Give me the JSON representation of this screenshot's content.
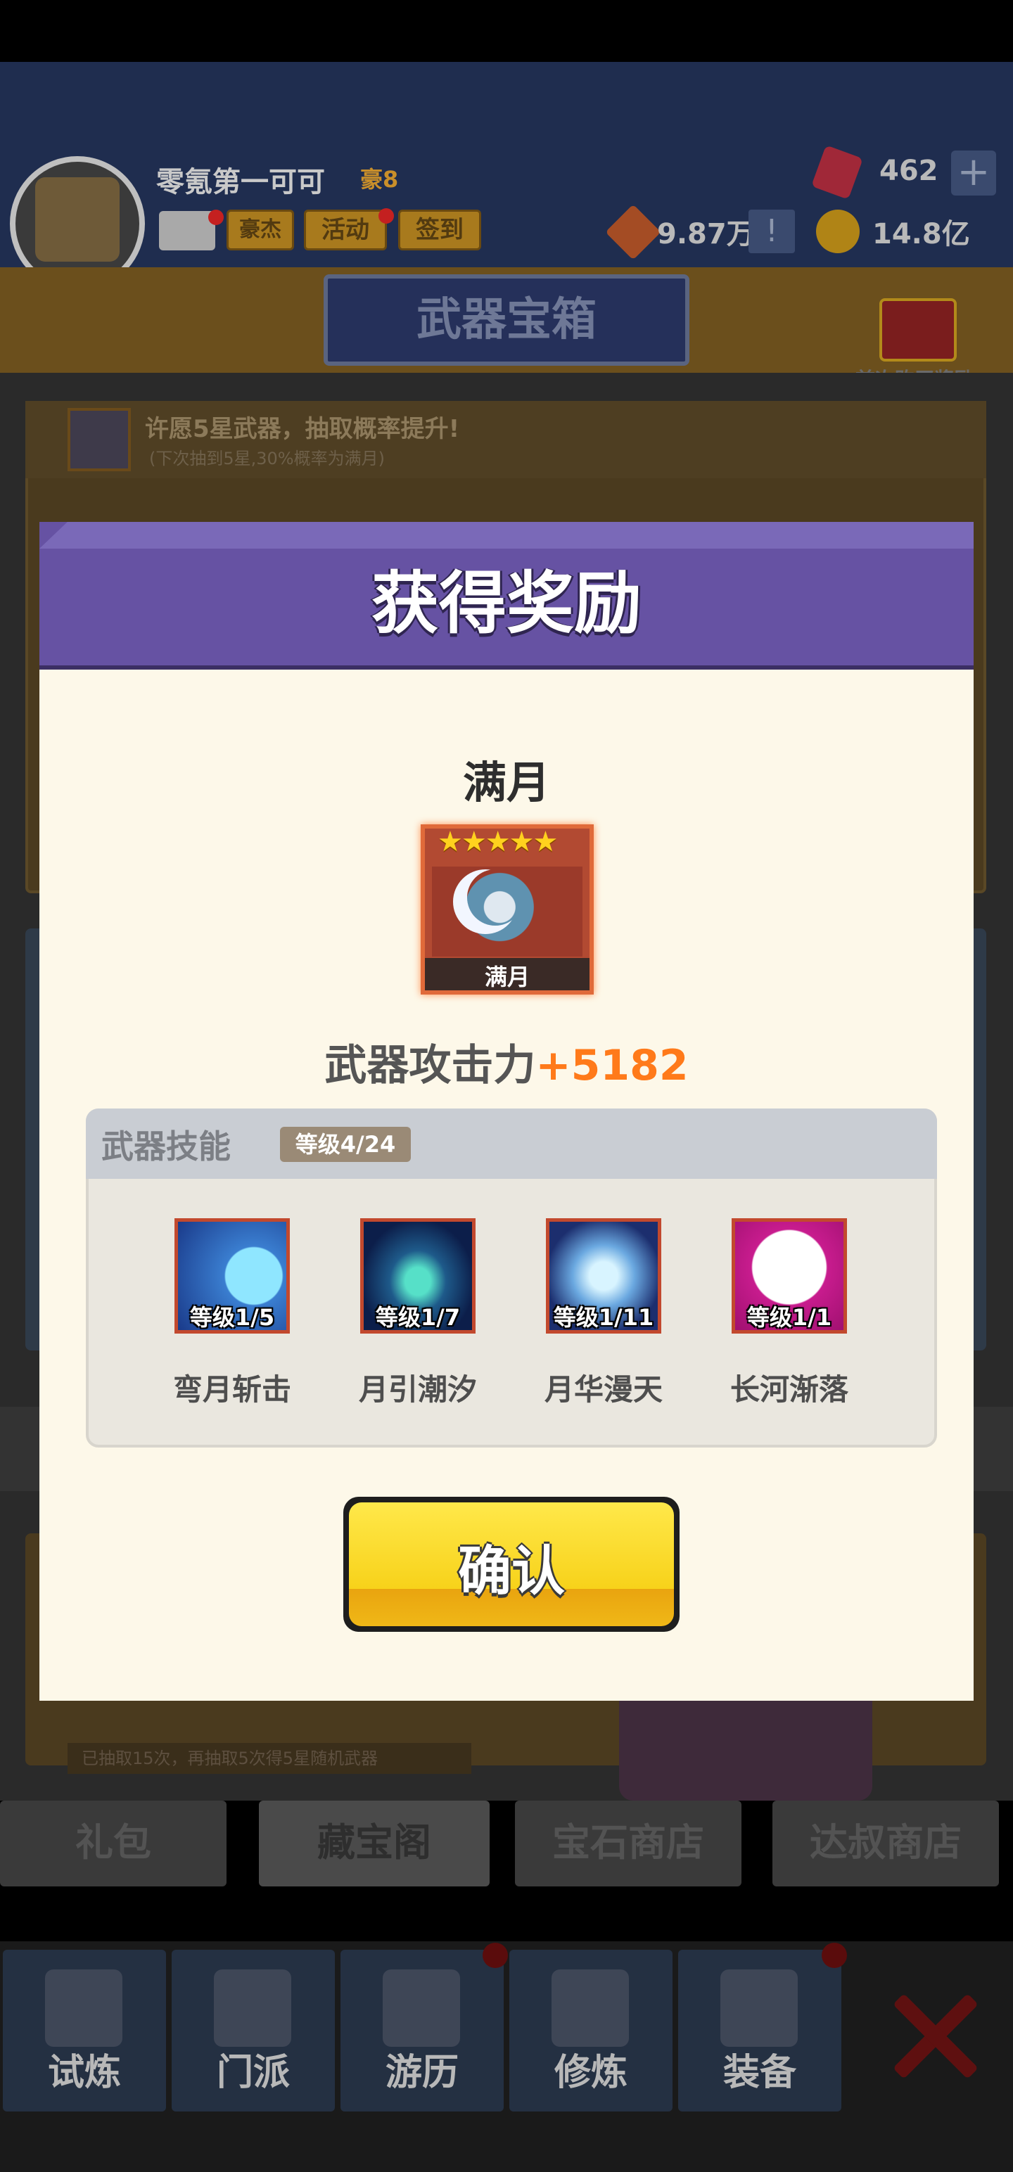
{
  "header": {
    "player_name": "零氪第一可可",
    "player_rank": "豪8",
    "buttons": [
      "豪杰",
      "活动",
      "签到"
    ],
    "gems": "462",
    "power": "9.87万",
    "coins": "14.8亿"
  },
  "store": {
    "title": "武器宝箱",
    "first_buy_label": "首次购买奖励",
    "wish_text": "许愿5星武器，抽取概率提升!",
    "wish_subtext": "(下次抽到5星,30%概率为满月)",
    "draw_note": "已抽取15次，再抽取5次得5星随机武器"
  },
  "shop_tabs": [
    "礼包",
    "藏宝阁",
    "宝石商店",
    "达叔商店"
  ],
  "bottom_nav": [
    "试炼",
    "门派",
    "游历",
    "修炼",
    "装备"
  ],
  "modal": {
    "title": "获得奖励",
    "reward_name": "满月",
    "card_label": "满月",
    "stars": "★★★★★",
    "attack_label": "武器攻击力",
    "attack_value": "+5182",
    "skills_title": "武器技能",
    "skills_level": "等级4/24",
    "skills": [
      {
        "level": "等级1/5",
        "name": "弯月斩击"
      },
      {
        "level": "等级1/7",
        "name": "月引潮汐"
      },
      {
        "level": "等级1/11",
        "name": "月华漫天"
      },
      {
        "level": "等级1/1",
        "name": "长河渐落"
      }
    ],
    "confirm_label": "确认"
  },
  "colors": {
    "modal_header": "#6652a3",
    "modal_body": "#fdf8e9",
    "attack_value": "#ff7a1a",
    "confirm_button": "#f7d21a"
  }
}
